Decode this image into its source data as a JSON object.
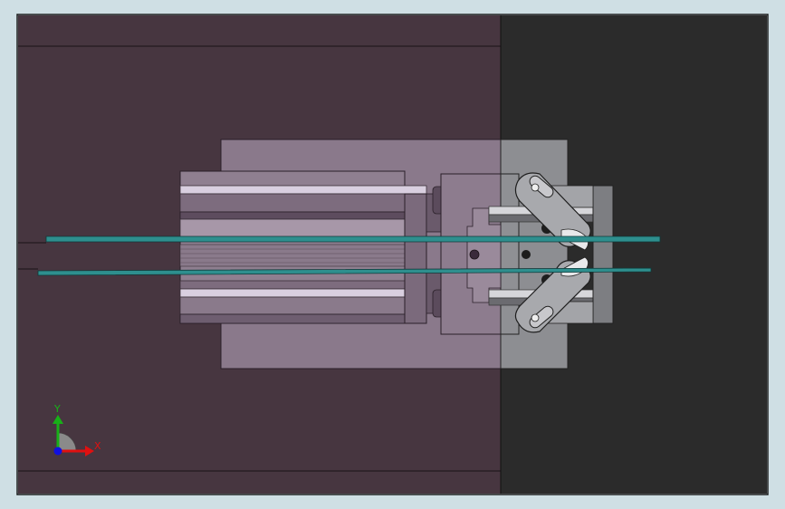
{
  "view": {
    "triad": {
      "x_label": "X",
      "y_label": "Y"
    },
    "colors": {
      "background_frame": "#cfdfe4",
      "plate_left": "#473640",
      "plate_right": "#2b2b2b",
      "body_purple": "#8b7a8c",
      "body_grey": "#8b8d90",
      "cylinder": "#8c7c8c",
      "rail_teal": "#2e8f8e",
      "triad_x": "#e01010",
      "triad_y": "#18b018",
      "triad_z": "#1010e0"
    }
  }
}
